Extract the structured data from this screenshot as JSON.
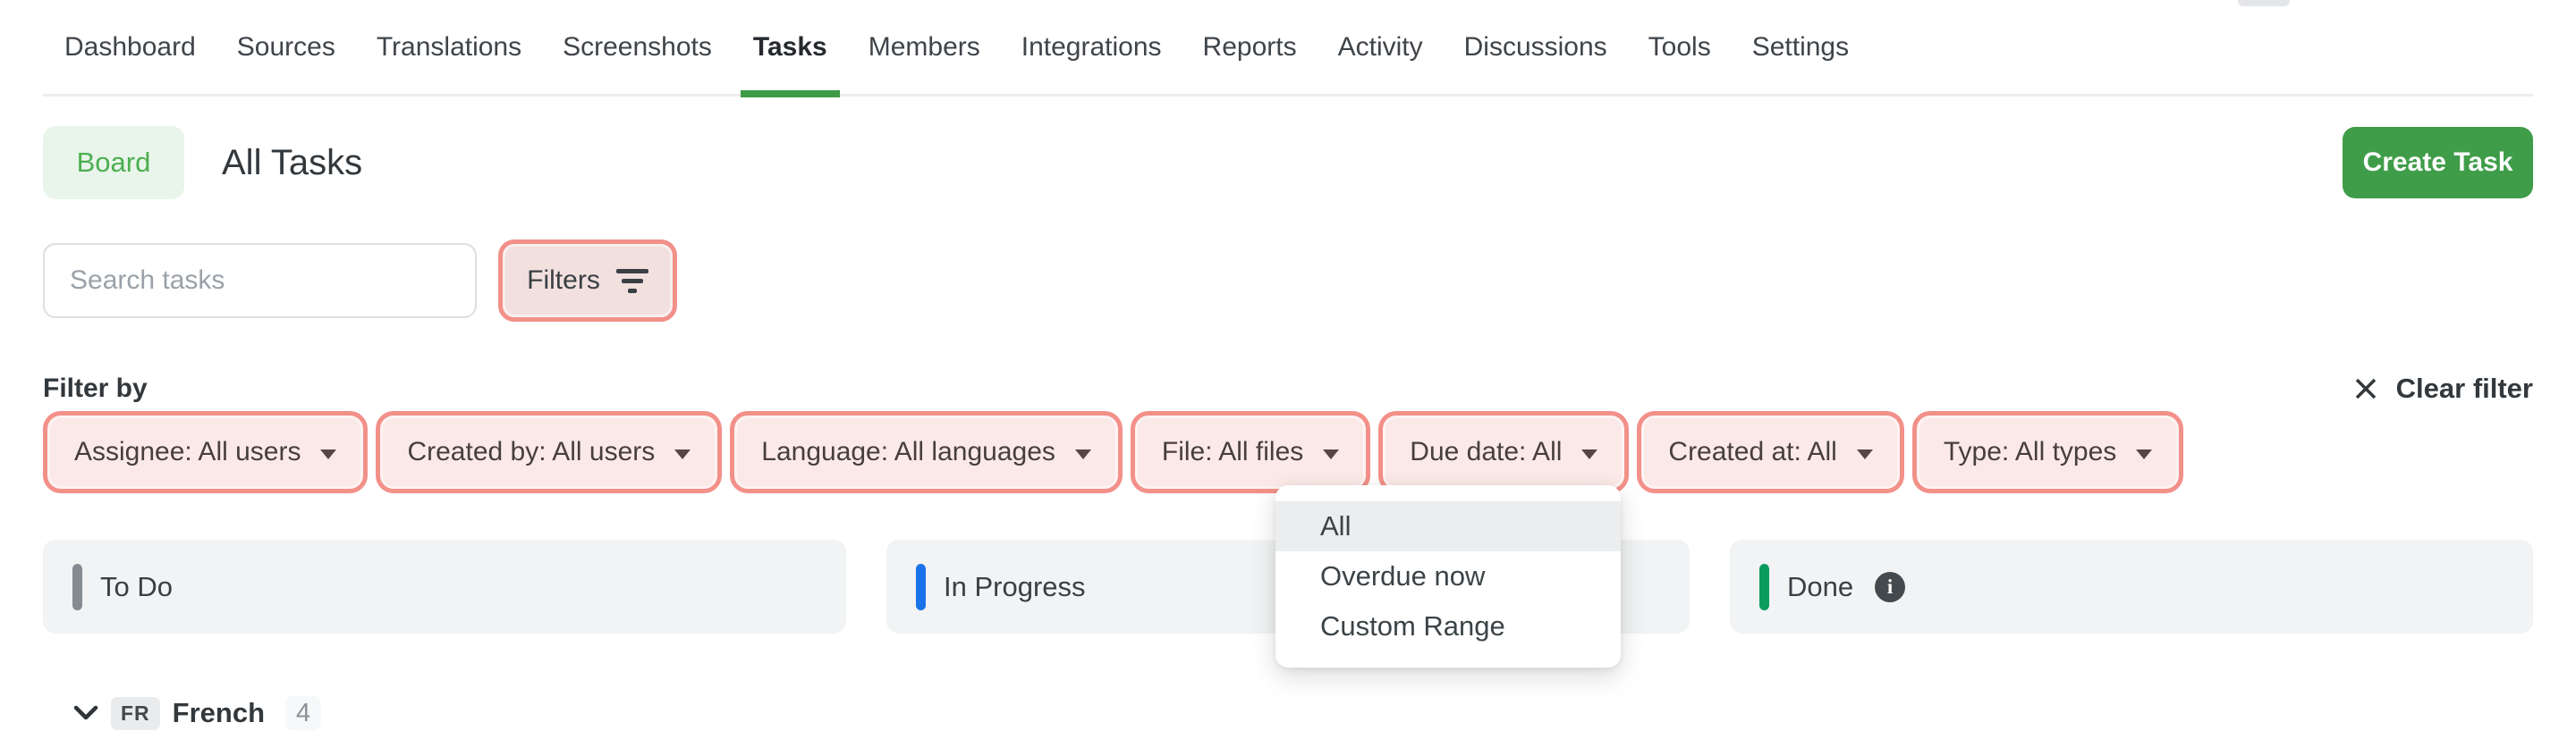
{
  "nav": {
    "items": [
      "Dashboard",
      "Sources",
      "Translations",
      "Screenshots",
      "Tasks",
      "Members",
      "Integrations",
      "Reports",
      "Activity",
      "Discussions",
      "Tools",
      "Settings"
    ],
    "active": "Tasks"
  },
  "header": {
    "view_toggle": "Board",
    "title": "All Tasks",
    "create_button": "Create Task"
  },
  "toolbar": {
    "search_placeholder": "Search tasks",
    "filters_button": "Filters"
  },
  "filter_bar": {
    "label": "Filter by",
    "clear_button": "Clear filter",
    "chips": [
      "Assignee: All users",
      "Created by: All users",
      "Language: All languages",
      "File: All files",
      "Due date: All",
      "Created at: All",
      "Type: All types"
    ]
  },
  "due_date_menu": {
    "options": [
      "All",
      "Overdue now",
      "Custom Range"
    ],
    "highlighted": "All"
  },
  "board": {
    "columns": [
      {
        "label": "To Do",
        "color": "#858b90"
      },
      {
        "label": "In Progress",
        "color": "#1a73e8"
      },
      {
        "label": "Done",
        "color": "#0a9c5c",
        "info_icon": "i"
      }
    ]
  },
  "group": {
    "code": "FR",
    "name": "French",
    "count": "4"
  },
  "colors": {
    "accent_green": "#3f9d46",
    "highlight_ring": "#f29089",
    "chip_fill": "#fbe9e8",
    "column_bg": "#f1f3f4"
  }
}
